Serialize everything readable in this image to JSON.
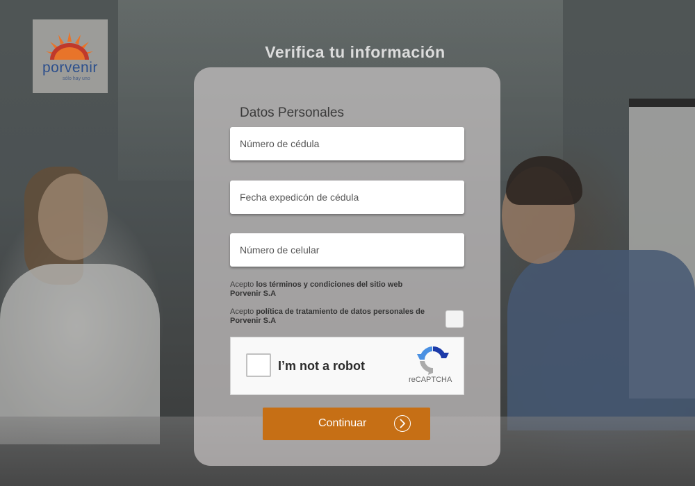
{
  "brand": {
    "name": "porvenir",
    "tagline": "sólo hay uno",
    "colors": {
      "sun_orange": "#e8742a",
      "sun_red": "#c0392b",
      "text_blue": "#2c4f8c"
    }
  },
  "page": {
    "title": "Verifica tu información"
  },
  "form": {
    "section_title": "Datos Personales",
    "fields": [
      {
        "placeholder": "Número de cédula",
        "value": ""
      },
      {
        "placeholder": "Fecha expedicón de cédula",
        "value": ""
      },
      {
        "placeholder": "Número de celular",
        "value": ""
      }
    ],
    "terms_1": {
      "prefix": "Acepto ",
      "link": "los términos y condiciones del sitio web Porvenir S.A"
    },
    "terms_2": {
      "prefix": "Acepto ",
      "link": "política de tratamiento de datos personales de Porvenir S.A"
    },
    "accept_checked": false,
    "captcha": {
      "label": "I’m not a robot",
      "brand": "reCAPTCHA",
      "checked": false
    },
    "submit": {
      "label": "Continuar",
      "color": "#c66f15"
    }
  }
}
